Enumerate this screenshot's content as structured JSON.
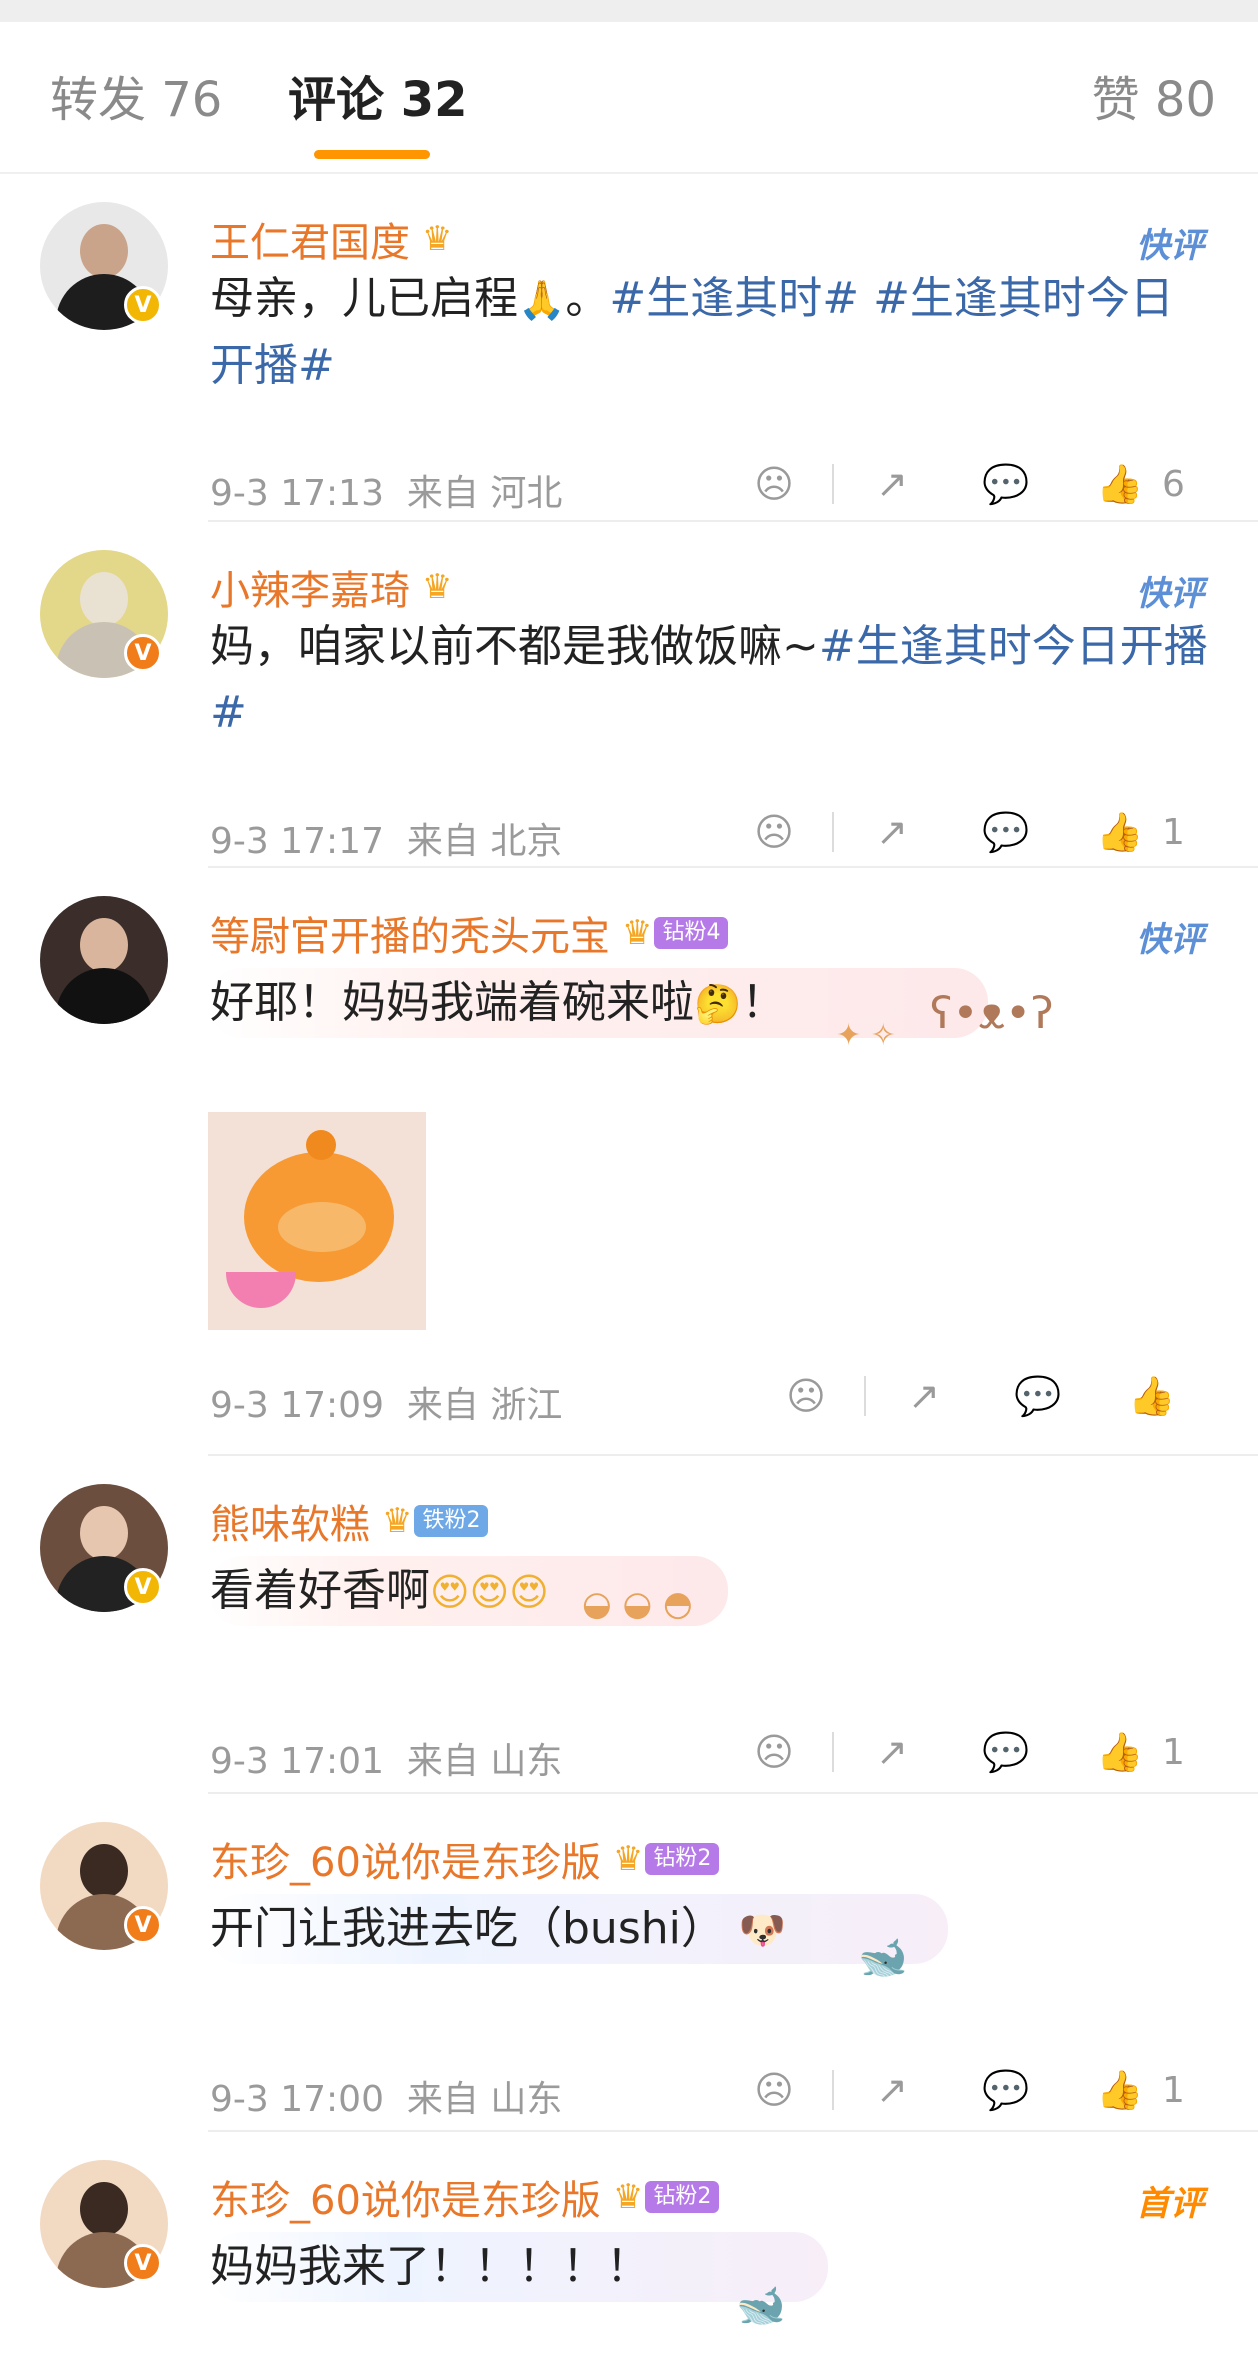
{
  "tabs": {
    "repost": "转发 76",
    "comment": "评论 32",
    "like": "赞 80"
  },
  "icons": {
    "dislike": "frown-icon",
    "share": "share-icon",
    "comment": "comment-icon",
    "like": "thumbs-up-icon"
  },
  "colors": {
    "accent": "#ff9500",
    "username": "#e8772a",
    "hashtag": "#3b68a8",
    "verified_gold": "#f2b705",
    "verified_orange": "#f07c1a"
  },
  "comments": [
    {
      "name": "王仁君国度",
      "tag": "快评",
      "text_plain": "母亲，儿已启程",
      "text_after": "。",
      "hashtag1": "#生逢其时#",
      "hashtag2": "#生逢其时今日开播#",
      "time": "9-3 17:13",
      "from": "来自 河北",
      "likes": "6"
    },
    {
      "name": "小辣李嘉琦",
      "tag": "快评",
      "text_plain": "妈，咱家以前不都是我做饭嘛~",
      "hashtag1": "#生逢其时今日开播#",
      "time": "9-3 17:17",
      "from": "来自 北京",
      "likes": "1"
    },
    {
      "name": "等尉官开播的秃头元宝",
      "badge": "钻粉4",
      "tag": "快评",
      "text_plain": "好耶！妈妈我端着碗来啦",
      "text_after": "！",
      "time": "9-3 17:09",
      "from": "来自 浙江",
      "likes": ""
    },
    {
      "name": "熊味软糕",
      "badge": "铁粉2",
      "text_plain": "看着好香啊",
      "time": "9-3 17:01",
      "from": "来自 山东",
      "likes": "1"
    },
    {
      "name": "东珍_60说你是东珍版",
      "badge": "钻粉2",
      "text_plain": "开门让我进去吃（bushi）",
      "time": "9-3 17:00",
      "from": "来自 山东",
      "likes": "1"
    },
    {
      "name": "东珍_60说你是东珍版",
      "badge": "钻粉2",
      "tag": "首评",
      "text_plain": "妈妈我来了！！！！！"
    }
  ]
}
